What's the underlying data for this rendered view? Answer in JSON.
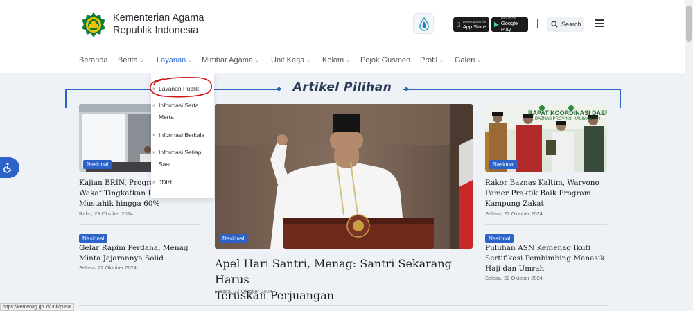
{
  "brand": {
    "line1": "Kementerian Agama",
    "line2": "Republik Indonesia"
  },
  "header": {
    "app_store": {
      "sub": "Download on the",
      "main": "App Store"
    },
    "google_play": {
      "sub": "GET IT ON",
      "main": "Google Play"
    },
    "search_label": "Search"
  },
  "nav": {
    "items": [
      {
        "label": "Beranda"
      },
      {
        "label": "Berita"
      },
      {
        "label": "Layanan"
      },
      {
        "label": "Mimbar Agama"
      },
      {
        "label": "Unit Kerja"
      },
      {
        "label": "Kolom"
      },
      {
        "label": "Pojok Gusmen"
      },
      {
        "label": "Profil"
      },
      {
        "label": "Galeri"
      }
    ]
  },
  "dropdown": {
    "items": [
      {
        "label": "Layanan Publik"
      },
      {
        "label": "Informasi Serta"
      },
      {
        "label": "Merta"
      },
      {
        "label": "Informasi Berkala"
      },
      {
        "label": "Informasi Setiap"
      },
      {
        "label": "Saat"
      },
      {
        "label": "JDIH"
      }
    ]
  },
  "section": {
    "title": "Artikel Pilihan"
  },
  "articles": {
    "left1": {
      "badge": "Nasional",
      "line1": "Kajian BRIN, Program",
      "line2": "Wakaf Tingkatkan Pe",
      "line3": "Mustahik hingga 60%",
      "date": "Rabu, 23 Oktober 2024"
    },
    "left2": {
      "badge": "Nasional",
      "line1": "Gelar Rapim Perdana, Menag",
      "line2": "Minta Jajarannya Solid",
      "date": "Selasa, 22 Oktober 2024"
    },
    "main": {
      "badge": "Nasional",
      "line1": "Apel Hari Santri, Menag: Santri Sekarang Harus",
      "line2": "Teruskan Perjuangan",
      "date": "Selasa, 22 Oktober 2024"
    },
    "right1": {
      "badge": "Nasional",
      "line1": "Rakor Baznas Kaltim, Waryono",
      "line2": "Pamer Praktik Baik Program",
      "line3": "Kampung Zakat",
      "date": "Selasa, 22 Oktober 2024",
      "banner": "RAPAT KOORDINASI DAERAH",
      "banner2": "BAZNAS PROVINSI KALIMANTAN"
    },
    "right2": {
      "badge": "Nasional",
      "line1": "Puluhan ASN Kemenag Ikuti",
      "line2": "Sertifikasi Pembimbing Manasik",
      "line3": "Haji dan Umrah",
      "date": "Selasa, 22 Oktober 2024"
    }
  },
  "status_url": "https://kemenag.go.id/unit/pusat",
  "colors": {
    "accent": "#2d63c8",
    "annotation": "#d01818",
    "nav_active": "#2f6fd6"
  }
}
